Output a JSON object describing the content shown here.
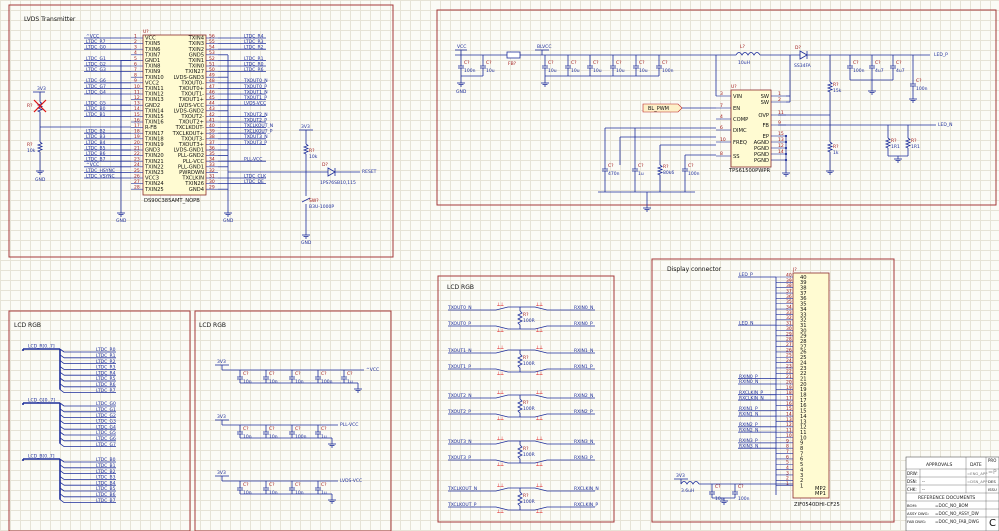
{
  "title_block": {
    "approvals": "APPROVALS",
    "date": "DATE",
    "drw": "DRW:",
    "dsn": "DSN:",
    "chk": "CHK:",
    "dash": "--",
    "ref_docs": "REFERENCE DOCUMENTS",
    "bom": "BOM:",
    "bom_val": "=DOC_NO_BOM",
    "assy": "ASSY DWG:",
    "assy_val": "=DOC_NO_ASSY_DW",
    "fab": "FAB DWG:",
    "fab_val": "=DOC_NO_FAB_DWG",
    "date_val": "=ENG_APP",
    "date_val2": "=DSN_APP",
    "r1": "=P",
    "r2": "PRO",
    "r3": "DES",
    "r4": "ISSU",
    "rev": "C"
  },
  "lvds": {
    "title": "LVDS Transmitter",
    "ic_ref": "U?",
    "ic_part": "DS90C385AMT_NOPB",
    "left_pins": [
      {
        "n": "1",
        "name": "VCC",
        "net": "^VCC"
      },
      {
        "n": "2",
        "name": "TXIN5",
        "net": "LTDC_R7"
      },
      {
        "n": "3",
        "name": "TXIN6",
        "net": "LTDC_G0"
      },
      {
        "n": "4",
        "name": "TXIN7",
        "net": ""
      },
      {
        "n": "5",
        "name": "GND1",
        "net": "LTDC_G1"
      },
      {
        "n": "6",
        "name": "TXIN8",
        "net": "LTDC_G2"
      },
      {
        "n": "7",
        "name": "TXIN9",
        "net": "LTDC_G3"
      },
      {
        "n": "8",
        "name": "TXIN10",
        "net": ""
      },
      {
        "n": "9",
        "name": "VCC2",
        "net": "LTDC_G6"
      },
      {
        "n": "10",
        "name": "TXIN11",
        "net": "LTDC_G7"
      },
      {
        "n": "11",
        "name": "TXIN12",
        "net": "LTDC_G4"
      },
      {
        "n": "12",
        "name": "TXIN13",
        "net": ""
      },
      {
        "n": "13",
        "name": "GND2",
        "net": "LTDC_G5"
      },
      {
        "n": "14",
        "name": "TXIN14",
        "net": "LTDC_B0"
      },
      {
        "n": "15",
        "name": "TXIN15",
        "net": "LTDC_B1"
      },
      {
        "n": "16",
        "name": "TXIN16",
        "net": ""
      },
      {
        "n": "17",
        "name": "R-FB",
        "net": ""
      },
      {
        "n": "18",
        "name": "TXIN17",
        "net": "LTDC_B2"
      },
      {
        "n": "19",
        "name": "TXIN18",
        "net": "LTDC_B3"
      },
      {
        "n": "20",
        "name": "TXIN19",
        "net": "LTDC_B4"
      },
      {
        "n": "21",
        "name": "GND3",
        "net": "LTDC_B5"
      },
      {
        "n": "22",
        "name": "TXIN20",
        "net": "LTDC_B6"
      },
      {
        "n": "23",
        "name": "TXIN21",
        "net": "LTDC_B7"
      },
      {
        "n": "24",
        "name": "TXIN22",
        "net": "^VCC"
      },
      {
        "n": "25",
        "name": "TXIN23",
        "net": "LTDC_HSYNC"
      },
      {
        "n": "26",
        "name": "VCC3",
        "net": "LTDC_VSYNC"
      },
      {
        "n": "27",
        "name": "TXIN24",
        "net": ""
      },
      {
        "n": "28",
        "name": "TXIN25",
        "net": ""
      }
    ],
    "right_pins": [
      {
        "n": "56",
        "name": "TXIN4",
        "net": "LTDC_R4"
      },
      {
        "n": "55",
        "name": "TXIN3",
        "net": "LTDC_R3"
      },
      {
        "n": "54",
        "name": "TXIN2",
        "net": "LTDC_R2"
      },
      {
        "n": "53",
        "name": "GND5",
        "net": ""
      },
      {
        "n": "52",
        "name": "TXIN1",
        "net": "LTDC_R1"
      },
      {
        "n": "51",
        "name": "TXIN0",
        "net": "LTDC_R0"
      },
      {
        "n": "50",
        "name": "TXIN27",
        "net": "LTDC_R6"
      },
      {
        "n": "49",
        "name": "LVDS-GND3",
        "net": ""
      },
      {
        "n": "48",
        "name": "TXOUT0-",
        "net": "TXOUT0_N"
      },
      {
        "n": "47",
        "name": "TXOUT0+",
        "net": "TXOUT0_P"
      },
      {
        "n": "46",
        "name": "TXOUT1-",
        "net": "TXOUT1_N"
      },
      {
        "n": "45",
        "name": "TXOUT1+",
        "net": "TXOUT1_P"
      },
      {
        "n": "44",
        "name": "LVDS-VCC",
        "net": "LVDS-VCC"
      },
      {
        "n": "43",
        "name": "LVDS-GND2",
        "net": ""
      },
      {
        "n": "42",
        "name": "TXOUT2-",
        "net": "TXOUT2_N"
      },
      {
        "n": "41",
        "name": "TXOUT2+",
        "net": "TXOUT2_P"
      },
      {
        "n": "40",
        "name": "TXCLKOUT-",
        "net": "TXCLKOUT_N"
      },
      {
        "n": "39",
        "name": "TXCLKOUT+",
        "net": "TXCLKOUT_P"
      },
      {
        "n": "38",
        "name": "TXOUT3-",
        "net": "TXOUT3_N"
      },
      {
        "n": "37",
        "name": "TXOUT3+",
        "net": "TXOUT3_P"
      },
      {
        "n": "36",
        "name": "LVDS-GND1",
        "net": ""
      },
      {
        "n": "35",
        "name": "PLL-GND2",
        "net": ""
      },
      {
        "n": "34",
        "name": "PLL-VCC",
        "net": "PLL-VCC"
      },
      {
        "n": "33",
        "name": "PLL-GND1",
        "net": ""
      },
      {
        "n": "32",
        "name": "PWRDWN",
        "net": ""
      },
      {
        "n": "31",
        "name": "TXCLKIN",
        "net": "LTDC_CLK"
      },
      {
        "n": "30",
        "name": "TXIN26",
        "net": "LTDC_DE"
      },
      {
        "n": "29",
        "name": "GND4",
        "net": ""
      }
    ],
    "v33": "3V3",
    "gnd": "GND",
    "r_ref": "R?",
    "r_val": "10k",
    "d_ref": "D?",
    "d_part": "1PS76SB10,115",
    "reset": "RESET",
    "sw_ref": "SW?",
    "sw_part": "B3U-1000P"
  },
  "power": {
    "vcc": "VCC",
    "blvcc": "BLVCC",
    "fb": "FB?",
    "c": "C?",
    "c10u": "10u",
    "c100n": "100n",
    "c470n": "470n",
    "c1u": "1u",
    "c4u7": "4u7",
    "c22u": "22u",
    "c100p": "100p",
    "c1n": "1n",
    "l_ref": "L?",
    "l_val": "10uH",
    "d_ref": "D?",
    "d_part": "SS34FA",
    "u_ref": "U?",
    "u_part": "TPS61500PWPR",
    "led_p": "LED_P",
    "led_n": "LED_N",
    "bl_pwm": "BL_PWM",
    "r15k": "15k",
    "r1k": "1k",
    "r1r1": "1R1",
    "r80k6": "80k6",
    "r_ref": "R?",
    "left_pins": [
      {
        "n": "3",
        "name": "VIN"
      },
      {
        "n": "7",
        "name": "EN"
      },
      {
        "n": "4",
        "name": "COMP"
      },
      {
        "n": "6",
        "name": "DIMC"
      },
      {
        "n": "10",
        "name": "FREQ"
      },
      {
        "n": "8",
        "name": "SS"
      }
    ],
    "right_pins": [
      {
        "n": "1",
        "name": "SW"
      },
      {
        "n": "2",
        "name": "SW"
      },
      {
        "n": "11",
        "name": "OVP"
      },
      {
        "n": "9",
        "name": "FB"
      },
      {
        "n": "15",
        "name": "EP"
      },
      {
        "n": "13",
        "name": "AGND"
      },
      {
        "n": "12",
        "name": "PGND"
      },
      {
        "n": "14",
        "name": "PGND"
      },
      {
        "n": "",
        "name": "PGND"
      }
    ]
  },
  "lcd_rgb_bus": {
    "title": "LCD RGB",
    "buses": [
      {
        "label": "LCD_R[0..7]",
        "nets": [
          "LTDC_R0",
          "LTDC_R1",
          "LTDC_R2",
          "LTDC_R3",
          "LTDC_R4",
          "LTDC_R5",
          "LTDC_R6",
          "LTDC_R7"
        ]
      },
      {
        "label": "LCD_G[0..7]",
        "nets": [
          "LTDC_G0",
          "LTDC_G1",
          "LTDC_G2",
          "LTDC_G3",
          "LTDC_G4",
          "LTDC_G5",
          "LTDC_G6",
          "LTDC_G7"
        ]
      },
      {
        "label": "LCD_B[0..7]",
        "nets": [
          "LTDC_B0",
          "LTDC_B1",
          "LTDC_B2",
          "LTDC_B3",
          "LTDC_B4",
          "LTDC_B5",
          "LTDC_B6",
          "LTDC_B7"
        ]
      }
    ]
  },
  "lcd_rgb_caps": {
    "title": "LCD RGB",
    "v33": "3V3",
    "rows": [
      {
        "net": "^VCC",
        "vals": [
          "10n",
          "10n",
          "10n",
          "100n",
          "1u"
        ]
      },
      {
        "net": "PLL-VCC",
        "vals": [
          "10n",
          "10n",
          "100n",
          "1u"
        ]
      },
      {
        "net": "LVDS-VCC",
        "vals": [
          "10n",
          "10n",
          "10n",
          "1u"
        ]
      }
    ],
    "c": "C?",
    "gnd": "GND"
  },
  "lcd_rgb_term": {
    "title": "LCD RGB",
    "r_ref": "R?",
    "r_val": "100R",
    "pairs": [
      {
        "in_n": "TXOUT0_N",
        "in_p": "TXOUT0_P",
        "out_n": "RXIN0_N",
        "out_p": "RXIN0_P"
      },
      {
        "in_n": "TXOUT1_N",
        "in_p": "TXOUT1_P",
        "out_n": "RXIN1_N",
        "out_p": "RXIN1_P"
      },
      {
        "in_n": "TXOUT2_N",
        "in_p": "TXOUT2_P",
        "out_n": "RXIN2_N",
        "out_p": "RXIN2_P"
      },
      {
        "in_n": "TXOUT3_N",
        "in_p": "TXOUT3_P",
        "out_n": "RXIN3_N",
        "out_p": "RXIN3_P"
      },
      {
        "in_n": "TXCLKOUT_N",
        "in_p": "TXCLKOUT_P",
        "out_n": "RXCLKIN_N",
        "out_p": "RXCLKIN_P"
      }
    ]
  },
  "display": {
    "title": "Display connector",
    "j_ref": "J?",
    "j_part": "ZIF0540DHI-CF25",
    "pins": [
      "40",
      "39",
      "38",
      "37",
      "36",
      "35",
      "34",
      "33",
      "32",
      "31",
      "30",
      "29",
      "28",
      "27",
      "26",
      "25",
      "24",
      "23",
      "22",
      "21",
      "20",
      "19",
      "18",
      "17",
      "16",
      "15",
      "14",
      "13",
      "12",
      "11",
      "10",
      "9",
      "8",
      "7",
      "6",
      "5",
      "4",
      "3",
      "2",
      "1"
    ],
    "mp1": "MP1",
    "mp2": "MP2",
    "nets": [
      {
        "pin": "40",
        "net": "LED_P"
      },
      {
        "pin": "31",
        "net": "LED_N"
      },
      {
        "pin": "21",
        "net": "RXIN0_P"
      },
      {
        "pin": "20",
        "net": "RXIN0_N"
      },
      {
        "pin": "18",
        "net": "RXCLKIN_P"
      },
      {
        "pin": "17",
        "net": "RXCLKIN_N"
      },
      {
        "pin": "15",
        "net": "RXIN1_P"
      },
      {
        "pin": "14",
        "net": "RXIN1_N"
      },
      {
        "pin": "12",
        "net": "RXIN2_P"
      },
      {
        "pin": "11",
        "net": "RXIN2_N"
      },
      {
        "pin": "9",
        "net": "RXIN3_P"
      },
      {
        "pin": "8",
        "net": "RXIN3_N"
      }
    ],
    "v33": "3V3",
    "l_val": "3.6uH",
    "c10u": "10u",
    "c100n": "100n",
    "c": "C?"
  }
}
